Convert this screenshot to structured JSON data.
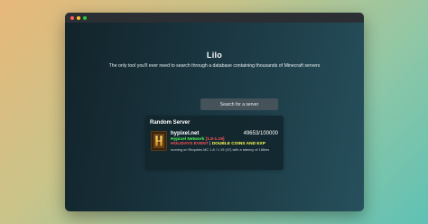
{
  "window": {
    "buttons": [
      "close",
      "minimize",
      "maximize"
    ],
    "colors": {
      "close": "#ff5f57",
      "minimize": "#febc2e",
      "maximize": "#28c840"
    }
  },
  "hero": {
    "title": "Lilo",
    "tagline": "The only tool you'll ever need to search through a database containing thousands of Minecraft servers"
  },
  "search": {
    "button_label": "Search for a server"
  },
  "random_server": {
    "heading": "Random Server",
    "icon": "hypixel-logo-icon",
    "address": "hypixel.net",
    "players": "49653/100000",
    "motd_line1_name": "Hypixel Network",
    "motd_line1_version": "[1.8-1.19]",
    "motd_line2_event": "HOLIDAYS EVENT",
    "motd_line2_sep": "|",
    "motd_line2_promo": "DOUBLE COINS AND EXP",
    "status": "running on Requires MC 1.8 / 1.19 (47) with a latency of 186ms",
    "colors": {
      "name": "#55ff55",
      "version": "#ff5555",
      "event": "#ff5555",
      "promo": "#ffff55",
      "separator": "#bbbbbb"
    }
  }
}
